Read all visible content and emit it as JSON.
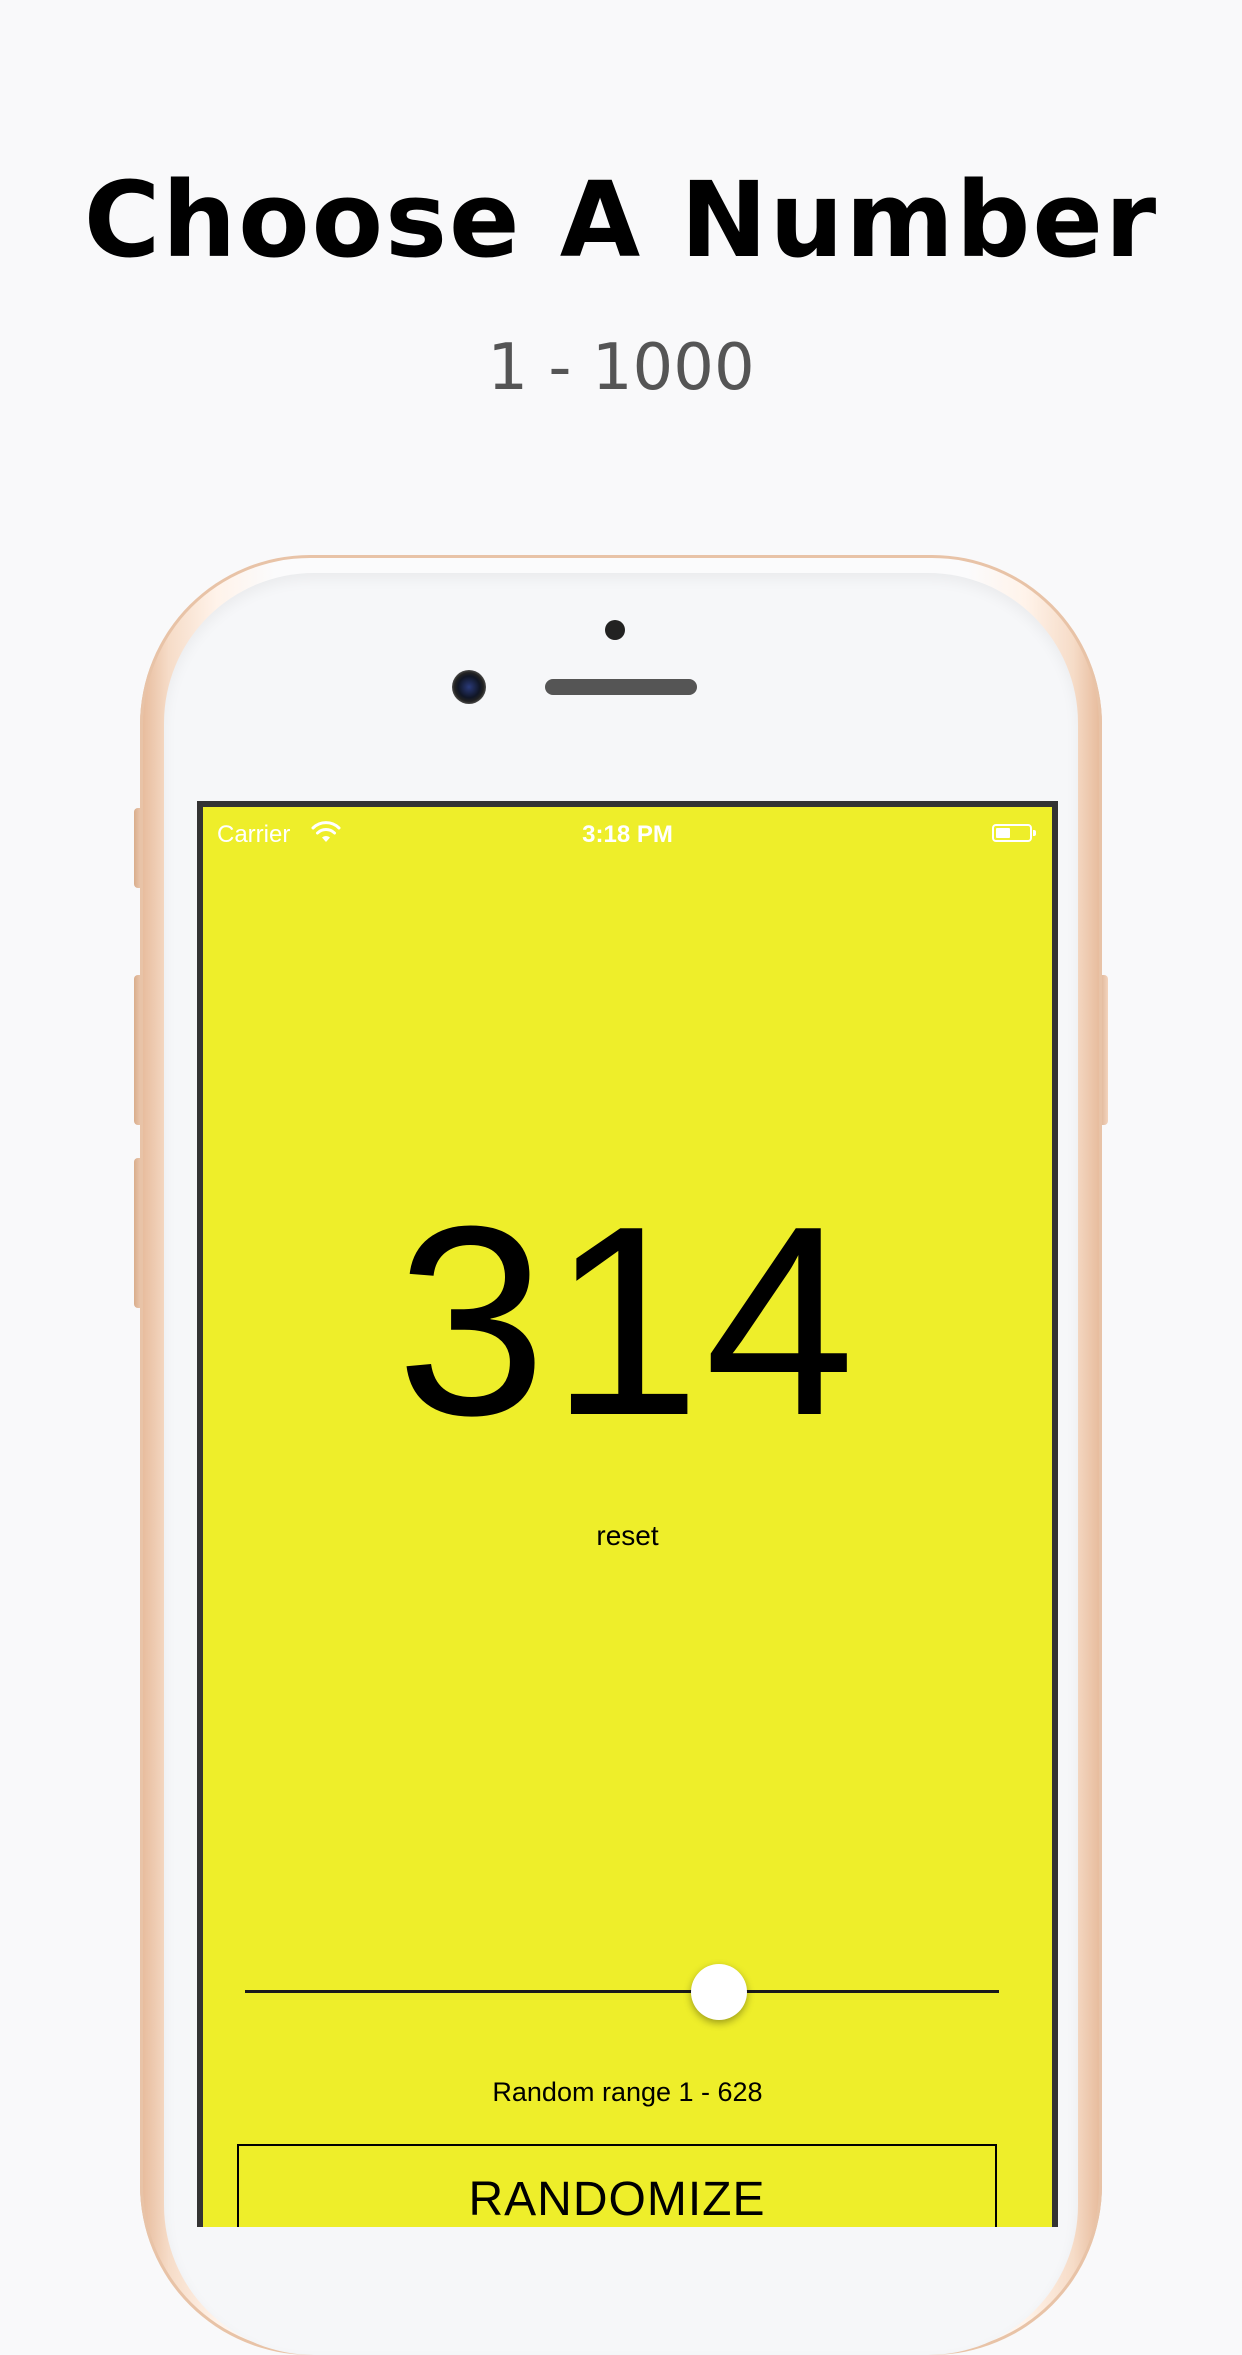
{
  "headline": "Choose A Number",
  "subhead": "1 - 1000",
  "status_bar": {
    "carrier": "Carrier",
    "time": "3:18 PM"
  },
  "app": {
    "number": "314",
    "reset_label": "reset",
    "slider_value_fraction": 0.628,
    "range_label": "Random range 1 - 628",
    "randomize_label": "RANDOMIZE"
  },
  "colors": {
    "screen_background": "#eeee2a",
    "page_background": "#f9f9fa"
  }
}
